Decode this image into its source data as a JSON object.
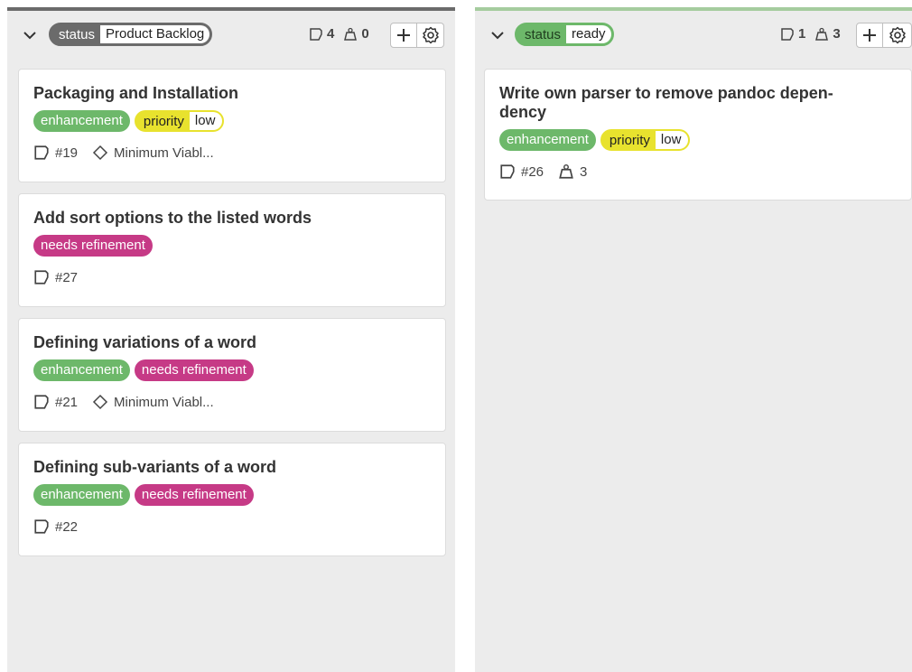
{
  "columns": [
    {
      "id": "backlog",
      "label_key": "status",
      "label_value": "Product Backlog",
      "issue_count": "4",
      "weight": "0",
      "cards": [
        {
          "title": "Packaging and Installation",
          "labels": [
            {
              "type": "enh",
              "text": "enhancement"
            }
          ],
          "priority": {
            "key": "priority",
            "value": "low"
          },
          "ref": "#19",
          "milestone": "Minimum Viabl..."
        },
        {
          "title": "Add sort options to the listed words",
          "labels": [
            {
              "type": "need",
              "text": "needs refinement"
            }
          ],
          "ref": "#27"
        },
        {
          "title": "Defining variations of a word",
          "labels": [
            {
              "type": "enh",
              "text": "enhancement"
            },
            {
              "type": "need",
              "text": "needs refinement"
            }
          ],
          "ref": "#21",
          "milestone": "Minimum Viabl..."
        },
        {
          "title": "Defining sub-variants of a word",
          "labels": [
            {
              "type": "enh",
              "text": "enhancement"
            },
            {
              "type": "need",
              "text": "needs refinement"
            }
          ],
          "ref": "#22"
        }
      ]
    },
    {
      "id": "ready",
      "label_key": "status",
      "label_value": "ready",
      "issue_count": "1",
      "weight": "3",
      "cards": [
        {
          "title_line1": "Write own parser to remove pandoc depen-",
          "title_line2": "dency",
          "labels": [
            {
              "type": "enh",
              "text": "enhancement"
            }
          ],
          "priority": {
            "key": "priority",
            "value": "low"
          },
          "ref": "#26",
          "weight": "3"
        }
      ]
    }
  ],
  "icons": [
    "chevron-down-icon",
    "issue-icon",
    "weight-icon",
    "plus-icon",
    "gear-icon",
    "milestone-icon"
  ],
  "colors": {
    "backlog_accent": "#6b6b6b",
    "ready_accent": "#a5cc9e",
    "enhancement": "#6db86a",
    "needs_refinement": "#c63a86",
    "priority": "#e8e22e"
  }
}
